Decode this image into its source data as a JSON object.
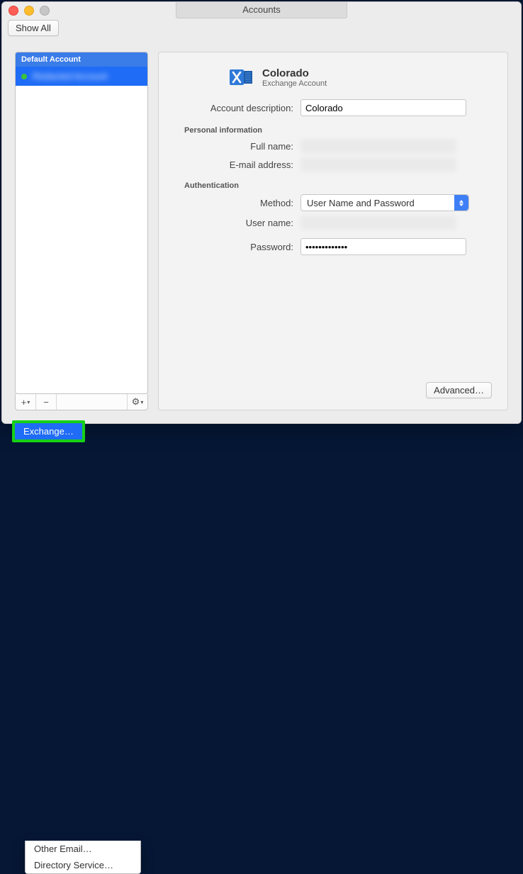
{
  "window": {
    "title": "Accounts"
  },
  "toolbar": {
    "show_all": "Show All"
  },
  "sidebar": {
    "header": "Default Account",
    "account_name": "Redacted Account",
    "footer": {
      "add": "+",
      "add_caret": "▾",
      "remove": "−",
      "gear": "⚙",
      "gear_caret": "▾"
    }
  },
  "popup": {
    "items": [
      {
        "label": "Exchange…",
        "selected": true
      },
      {
        "label": "Other Email…",
        "selected": false
      },
      {
        "label": "Directory Service…",
        "selected": false
      }
    ]
  },
  "pane": {
    "account_title": "Colorado",
    "account_subtitle": "Exchange Account",
    "labels": {
      "description": "Account description:",
      "personal_info": "Personal information",
      "full_name": "Full name:",
      "email": "E-mail address:",
      "authentication": "Authentication",
      "method": "Method:",
      "user_name": "User name:",
      "password": "Password:"
    },
    "values": {
      "description": "Colorado",
      "method": "User Name and Password",
      "password": "•••••••••••••"
    },
    "advanced": "Advanced…"
  }
}
